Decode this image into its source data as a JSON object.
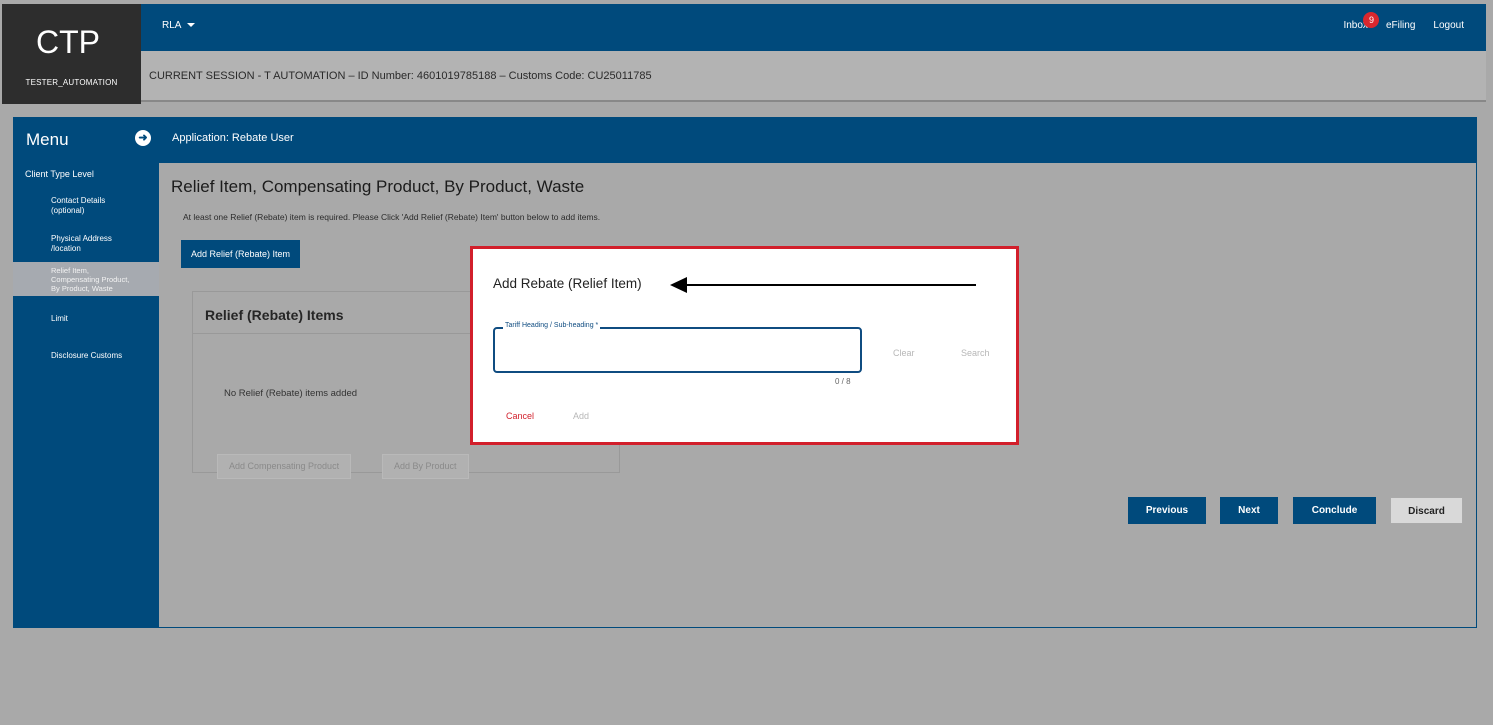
{
  "brand": {
    "logo": "CTP",
    "user": "TESTER_AUTOMATION"
  },
  "topbar": {
    "role": "RLA",
    "inbox": "Inbox",
    "inbox_badge": "9",
    "efiling": "eFiling",
    "logout": "Logout",
    "icons": [
      "chevron-down-icon"
    ]
  },
  "session": {
    "text": "CURRENT SESSION - T AUTOMATION – ID Number: 4601019785188 – Customs Code: CU25011785"
  },
  "menu": {
    "title": "Menu",
    "toggle_icon": "arrow-right-circle-icon",
    "application_label": "Application: Rebate User",
    "group_label": "Client Type Level",
    "items": [
      {
        "label": "Contact Details (optional)"
      },
      {
        "label": "Physical Address /location"
      },
      {
        "label": "Relief Item, Compensating Product, By Product, Waste"
      },
      {
        "label": "Limit"
      },
      {
        "label": "Disclosure Customs"
      }
    ]
  },
  "main": {
    "title": "Relief Item, Compensating Product, By Product, Waste",
    "subtitle": "At least one Relief (Rebate) item is required. Please Click 'Add Relief (Rebate) Item' button below to add items.",
    "add_relief_button": "Add Relief (Rebate) Item",
    "panel": {
      "title": "Relief (Rebate) Items",
      "empty_text": "No Relief (Rebate) items added",
      "compensating_button": "Add Compensating Product",
      "by_product_button": "Add By Product"
    },
    "nav": {
      "previous": "Previous",
      "next": "Next",
      "conclude": "Conclude",
      "discard": "Discard"
    }
  },
  "modal": {
    "title": "Add Rebate (Relief Item)",
    "field_label": "Tariff Heading / Sub-heading *",
    "field_value": "",
    "char_count": "0 / 8",
    "clear": "Clear",
    "search": "Search",
    "cancel": "Cancel",
    "add": "Add",
    "annotation_icon": "arrow-left-icon"
  },
  "colors": {
    "primary": "#004a7c",
    "highlight_border": "#d21f2b",
    "overlay": "#a9a9a9"
  }
}
